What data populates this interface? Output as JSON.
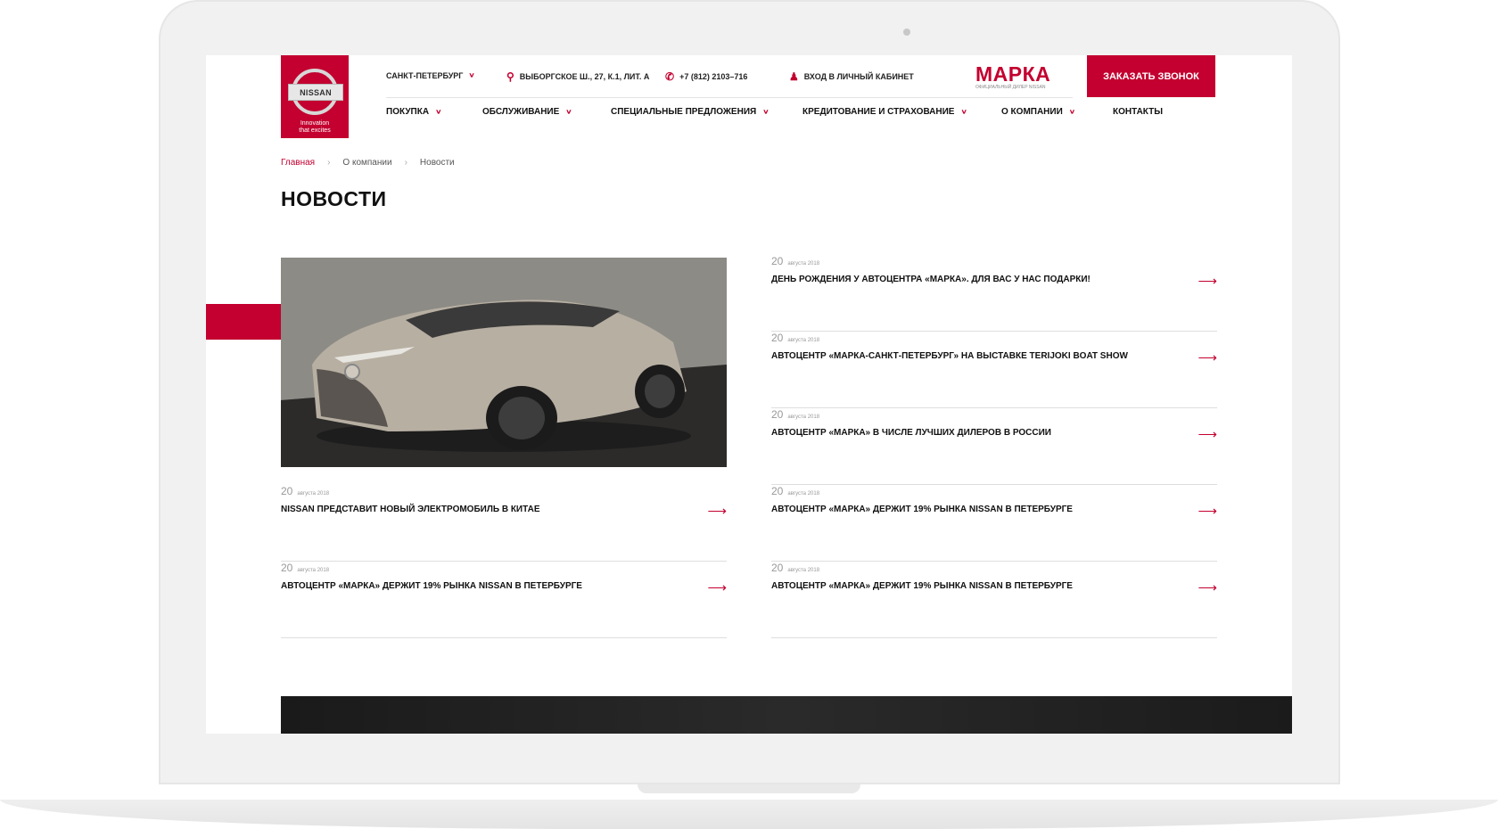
{
  "colors": {
    "accent": "#c3002f",
    "text": "#111111",
    "muted": "#999999"
  },
  "logo": {
    "wordmark": "NISSAN",
    "tagline_line1": "Innovation",
    "tagline_line2": "that excites"
  },
  "topbar": {
    "city": "Санкт-Петербург",
    "address": "Выборгское ш., 27, к.1, лит. А",
    "phone": "+7 (812) 2103–716",
    "login": "Вход в личный кабинет"
  },
  "brand": {
    "name": "МАРКА",
    "subtitle": "Официальный дилер Nissan"
  },
  "cta": {
    "label": "Заказать звонок"
  },
  "nav": {
    "items": [
      {
        "label": "Покупка"
      },
      {
        "label": "Обслуживание"
      },
      {
        "label": "Специальные предложения"
      },
      {
        "label": "Кредитование и страхование"
      },
      {
        "label": "О компании"
      },
      {
        "label": "Контакты"
      }
    ]
  },
  "breadcrumb": {
    "home": "Главная",
    "section": "О компании",
    "current": "Новости"
  },
  "page": {
    "title": "НОВОСТИ"
  },
  "news": [
    {
      "day": "20",
      "month": "августа 2018",
      "title": "Nissan представит новый электромобиль в Китае"
    },
    {
      "day": "20",
      "month": "августа 2018",
      "title": "Автоцентр «Марка» держит 19% рынка Nissan в Петербурге"
    },
    {
      "day": "20",
      "month": "августа 2018",
      "title": "День рождения у автоцентра «Марка». Для вас у нас подарки!"
    },
    {
      "day": "20",
      "month": "августа 2018",
      "title": "Автоцентр «Марка-Санкт-Петербург»  на выставке Terijoki Boat Show"
    },
    {
      "day": "20",
      "month": "августа 2018",
      "title": "Автоцентр «Марка» в числе лучших дилеров в России"
    },
    {
      "day": "20",
      "month": "августа 2018",
      "title": "Автоцентр «Марка» держит 19% рынка Nissan в Петербурге"
    },
    {
      "day": "20",
      "month": "августа 2018",
      "title": "Автоцентр «Марка» держит 19% рынка Nissan в Петербурге"
    }
  ],
  "icons": {
    "arrow": "arrow-right-icon",
    "chevron": "chevron-down-icon",
    "location": "location-pin-icon",
    "phone": "phone-icon",
    "user": "user-icon"
  }
}
